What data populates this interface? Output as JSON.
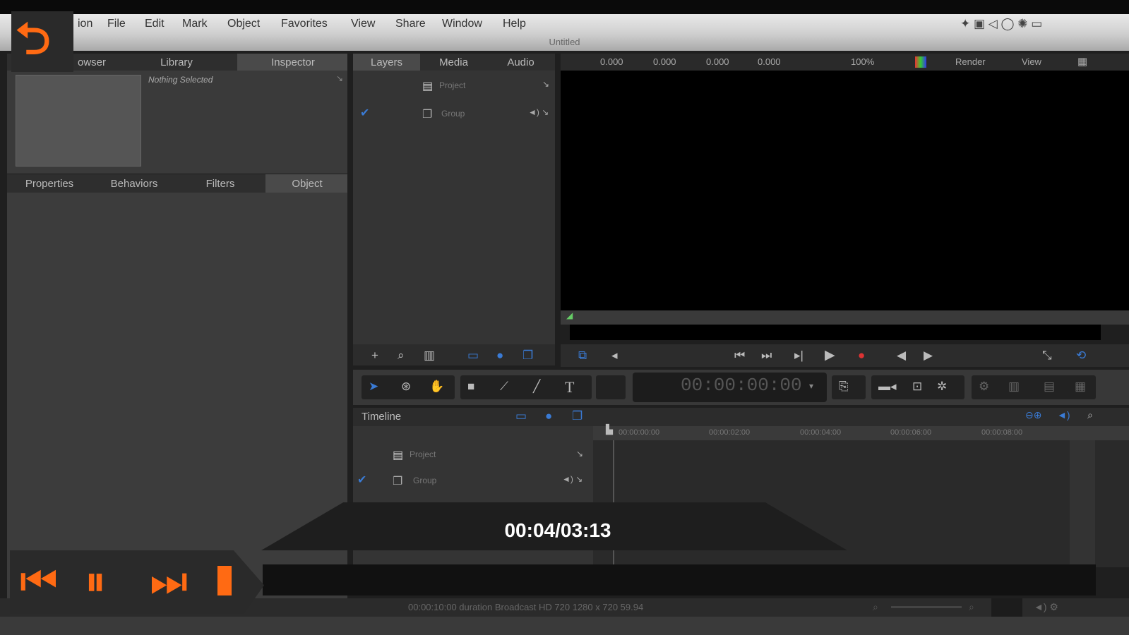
{
  "menu": {
    "app_name_fragment": "ion",
    "items": [
      "File",
      "Edit",
      "Mark",
      "Object",
      "Favorites",
      "View",
      "Share",
      "Window",
      "Help"
    ]
  },
  "window": {
    "title": "Untitled"
  },
  "left_panel": {
    "tabs": [
      "owser",
      "Library",
      "Inspector"
    ],
    "nothing_selected": "Nothing Selected",
    "sub_tabs": [
      "Properties",
      "Behaviors",
      "Filters",
      "Object"
    ]
  },
  "layers_panel": {
    "tabs": [
      "Layers",
      "Media",
      "Audio"
    ],
    "rows": [
      "Project",
      "Group"
    ]
  },
  "canvas_toolbar": {
    "values": [
      "0.000",
      "0.000",
      "0.000",
      "0.000"
    ],
    "zoom": "100%",
    "render": "Render",
    "view": "View"
  },
  "transport": {
    "timecode": "00:00:00:00"
  },
  "timeline": {
    "title": "Timeline",
    "rows": [
      "Project",
      "Group"
    ],
    "ruler": [
      "00:00:00:00",
      "00:00:02:00",
      "00:00:04:00",
      "00:00:06:00",
      "00:00:08:00"
    ]
  },
  "status_bar": {
    "text": "00:00:10:00 duration Broadcast HD 720 1280 x 720 59.94"
  },
  "overlay": {
    "time": "00:04/03:13",
    "controls": [
      "back-icon",
      "previous-icon",
      "pause-icon",
      "next-icon"
    ],
    "accent_color": "#ff6a13"
  }
}
